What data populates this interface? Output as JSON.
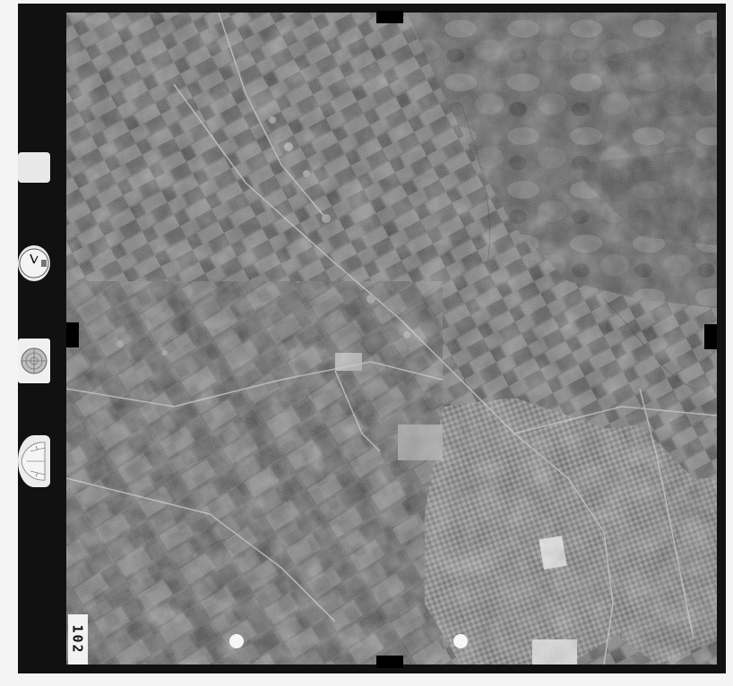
{
  "frame_number": "102",
  "calibration_marks": {
    "altimeter_label": "",
    "clock_label": "",
    "level_label_top": "",
    "level_label_bottom": "",
    "counter_label": ""
  },
  "colors": {
    "film_border": "#111111",
    "paper": "#f4f4f4"
  }
}
